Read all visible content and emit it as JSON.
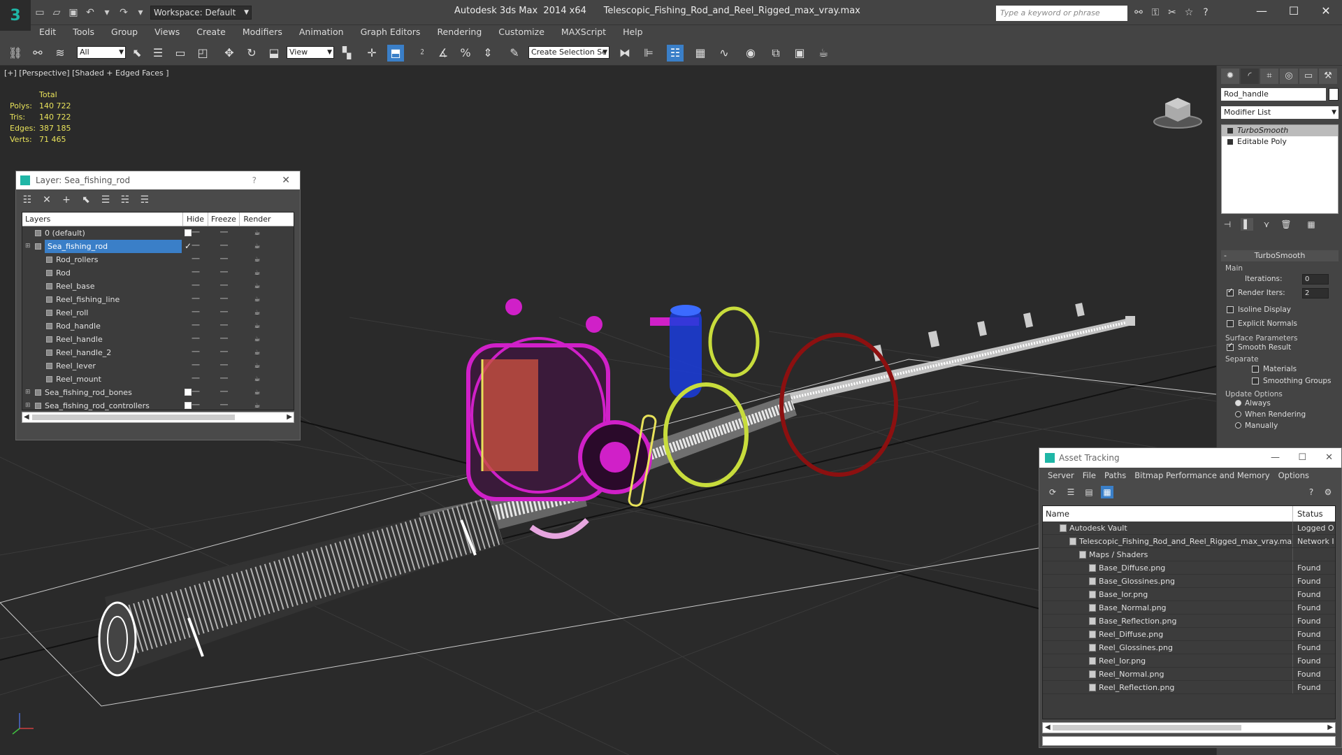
{
  "app": {
    "title": "Autodesk 3ds Max  2014 x64      Telescopic_Fishing_Rod_and_Reel_Rigged_max_vray.max",
    "workspace": "Workspace: Default",
    "search_placeholder": "Type a keyword or phrase"
  },
  "menu": [
    "Edit",
    "Tools",
    "Group",
    "Views",
    "Create",
    "Modifiers",
    "Animation",
    "Graph Editors",
    "Rendering",
    "Customize",
    "MAXScript",
    "Help"
  ],
  "toolbar": {
    "selection_filter": "All",
    "ref_coord": "View",
    "named_selection": "Create Selection Se"
  },
  "viewport": {
    "label": "[+] [Perspective] [Shaded + Edged Faces ]",
    "stats": {
      "header": "Total",
      "rows": [
        {
          "k": "Polys:",
          "v": "140 722"
        },
        {
          "k": "Tris:",
          "v": "140 722"
        },
        {
          "k": "Edges:",
          "v": "387 185"
        },
        {
          "k": "Verts:",
          "v": "71 465"
        }
      ]
    }
  },
  "layer_dialog": {
    "title": "Layer: Sea_fishing_rod",
    "help": "?",
    "columns": [
      "Layers",
      "Hide",
      "Freeze",
      "Render"
    ],
    "rows": [
      {
        "name": "0 (default)",
        "level": 0,
        "box": true,
        "check": false,
        "sel": false,
        "expand": false
      },
      {
        "name": "Sea_fishing_rod",
        "level": 0,
        "box": false,
        "check": true,
        "sel": true,
        "expand": true
      },
      {
        "name": "Rod_rollers",
        "level": 1
      },
      {
        "name": "Rod",
        "level": 1
      },
      {
        "name": "Reel_base",
        "level": 1
      },
      {
        "name": "Reel_fishing_line",
        "level": 1
      },
      {
        "name": "Reel_roll",
        "level": 1
      },
      {
        "name": "Rod_handle",
        "level": 1
      },
      {
        "name": "Reel_handle",
        "level": 1
      },
      {
        "name": "Reel_handle_2",
        "level": 1
      },
      {
        "name": "Reel_lever",
        "level": 1
      },
      {
        "name": "Reel_mount",
        "level": 1
      },
      {
        "name": "Sea_fishing_rod_bones",
        "level": 0,
        "box": true,
        "expand": true
      },
      {
        "name": "Sea_fishing_rod_controllers",
        "level": 0,
        "box": true,
        "expand": true
      }
    ]
  },
  "command_panel": {
    "object_name": "Rod_handle",
    "modifier_list": "Modifier List",
    "stack": [
      "TurboSmooth",
      "Editable Poly"
    ],
    "rollout": {
      "title": "TurboSmooth",
      "main": "Main",
      "iterations_label": "Iterations:",
      "iterations": "0",
      "render_iters_label": "Render Iters:",
      "render_iters": "2",
      "isoline": "Isoline Display",
      "explicit": "Explicit Normals",
      "surface": "Surface Parameters",
      "smooth_result": "Smooth Result",
      "separate": "Separate",
      "materials": "Materials",
      "smoothing_groups": "Smoothing Groups",
      "update": "Update Options",
      "always": "Always",
      "when_rendering": "When Rendering",
      "manually": "Manually"
    }
  },
  "asset_tracking": {
    "title": "Asset Tracking",
    "menu": [
      "Server",
      "File",
      "Paths",
      "Bitmap Performance and Memory",
      "Options"
    ],
    "columns": [
      "Name",
      "Status"
    ],
    "rows": [
      {
        "name": "Autodesk Vault",
        "status": "Logged O",
        "level": 1
      },
      {
        "name": "Telescopic_Fishing_Rod_and_Reel_Rigged_max_vray.max",
        "status": "Network I",
        "level": 2
      },
      {
        "name": "Maps / Shaders",
        "status": "",
        "level": 3
      },
      {
        "name": "Base_Diffuse.png",
        "status": "Found",
        "level": 4
      },
      {
        "name": "Base_Glossines.png",
        "status": "Found",
        "level": 4
      },
      {
        "name": "Base_Ior.png",
        "status": "Found",
        "level": 4
      },
      {
        "name": "Base_Normal.png",
        "status": "Found",
        "level": 4
      },
      {
        "name": "Base_Reflection.png",
        "status": "Found",
        "level": 4
      },
      {
        "name": "Reel_Diffuse.png",
        "status": "Found",
        "level": 4
      },
      {
        "name": "Reel_Glossines.png",
        "status": "Found",
        "level": 4
      },
      {
        "name": "Reel_Ior.png",
        "status": "Found",
        "level": 4
      },
      {
        "name": "Reel_Normal.png",
        "status": "Found",
        "level": 4
      },
      {
        "name": "Reel_Reflection.png",
        "status": "Found",
        "level": 4
      }
    ]
  },
  "colors": {
    "accent": "#3a7fc8",
    "stats": "#e8e25a",
    "reel": "#d020c8",
    "ring_green": "#c8dc3c",
    "ring_red": "#8c1010",
    "handle_blue": "#1a3cdc"
  }
}
